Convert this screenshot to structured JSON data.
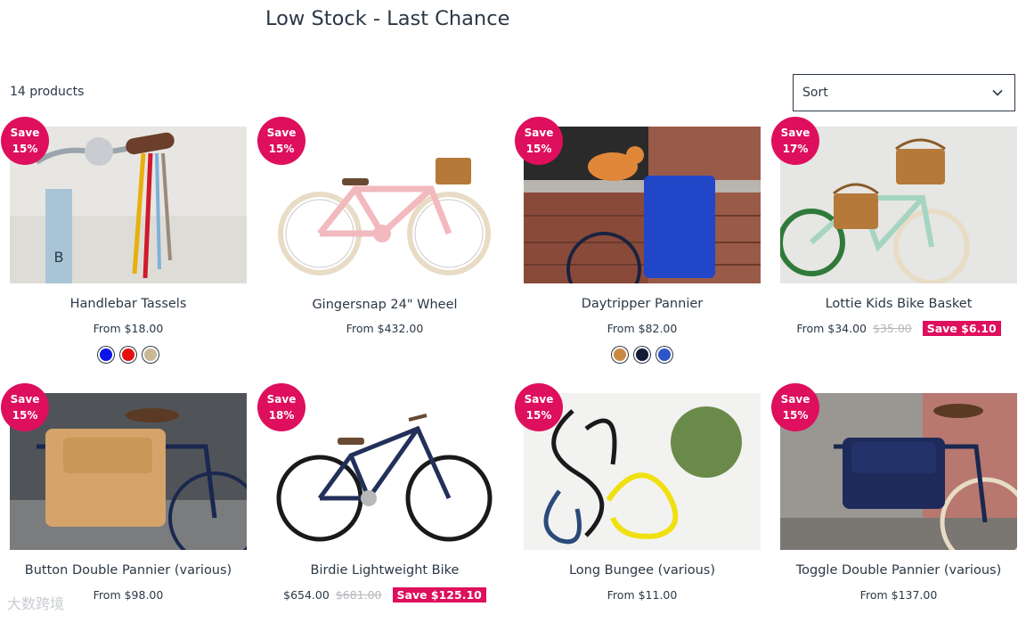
{
  "page": {
    "title": "Low Stock - Last Chance"
  },
  "toolbar": {
    "count_label": "14 products",
    "sort_label": "Sort"
  },
  "products": [
    {
      "name": "Handlebar Tassels",
      "price": "From $18.00",
      "badge_top": "Save",
      "badge_pct": "15%",
      "swatches": [
        "#0a14e8",
        "#e8100e",
        "#c8b894"
      ]
    },
    {
      "name": "Gingersnap 24\" Wheel",
      "price": "From $432.00",
      "badge_top": "Save",
      "badge_pct": "15%"
    },
    {
      "name": "Daytripper Pannier",
      "price": "From $82.00",
      "badge_top": "Save",
      "badge_pct": "15%",
      "swatches": [
        "#c98b43",
        "#121a36",
        "#2f55c8"
      ]
    },
    {
      "name": "Lottie Kids Bike Basket",
      "price": "From $34.00",
      "old_price": "$35.00",
      "save_tag": "Save $6.10",
      "badge_top": "Save",
      "badge_pct": "17%"
    },
    {
      "name": "Button Double Pannier (various)",
      "price": "From $98.00",
      "badge_top": "Save",
      "badge_pct": "15%"
    },
    {
      "name": "Birdie Lightweight Bike",
      "price": "$654.00",
      "old_price": "$681.00",
      "save_tag": "Save $125.10",
      "badge_top": "Save",
      "badge_pct": "18%"
    },
    {
      "name": "Long Bungee (various)",
      "price": "From $11.00",
      "badge_top": "Save",
      "badge_pct": "15%"
    },
    {
      "name": "Toggle Double Pannier (various)",
      "price": "From $137.00",
      "badge_top": "Save",
      "badge_pct": "15%"
    }
  ],
  "watermark": "大数跨境",
  "colors": {
    "brand": "#de0f5c",
    "text": "#2b3846"
  }
}
